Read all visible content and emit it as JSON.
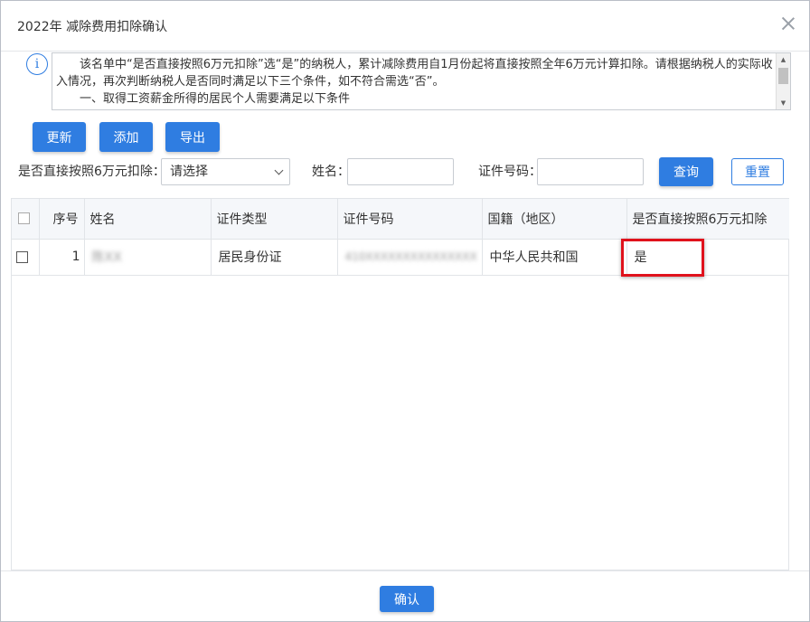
{
  "dialog": {
    "title": "2022年 减除费用扣除确认"
  },
  "notice": {
    "line1": "该名单中“是否直接按照6万元扣除”选“是”的纳税人，累计减除费用自1月份起将直接按照全年6万元计算扣除。请根据纳税人的实际收入情况，再次判断纳税人是否同时满足以下三个条件，如不符合需选“否”。",
    "line2": "一、取得工资薪金所得的居民个人需要满足以下条件"
  },
  "toolbar": {
    "update": "更新",
    "add": "添加",
    "export": "导出"
  },
  "filters": {
    "direct_label": "是否直接按照6万元扣除：",
    "direct_select": "请选择",
    "name_label": "姓名：",
    "id_label": "证件号码：",
    "query": "查询",
    "reset": "重置"
  },
  "table": {
    "headers": [
      "序号",
      "姓名",
      "证件类型",
      "证件号码",
      "国籍（地区）",
      "是否直接按照6万元扣除"
    ],
    "rows": [
      {
        "index": "1",
        "name": "陈XX",
        "id_type": "居民身份证",
        "id_number": "410XXXXXXXXXXXXXXX",
        "nationality": "中华人民共和国",
        "direct": "是"
      }
    ]
  },
  "footer": {
    "confirm": "确认"
  },
  "colors": {
    "primary": "#2f7de1",
    "highlight": "#e0121c"
  }
}
